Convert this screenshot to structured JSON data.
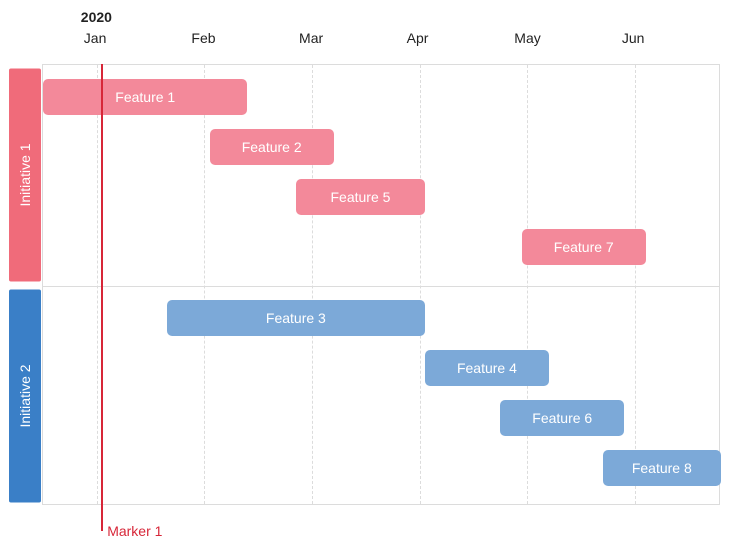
{
  "header": {
    "year": "2020",
    "months": [
      "Jan",
      "Feb",
      "Mar",
      "Apr",
      "May",
      "Jun"
    ]
  },
  "swimlanes": [
    {
      "id": "initiative-1",
      "label": "Initiative 1",
      "color": "pink"
    },
    {
      "id": "initiative-2",
      "label": "Initiative 2",
      "color": "blue"
    }
  ],
  "bars": [
    {
      "id": "feature-1",
      "label": "Feature 1",
      "lane": 0,
      "row": 0,
      "color": "pink"
    },
    {
      "id": "feature-2",
      "label": "Feature 2",
      "lane": 0,
      "row": 1,
      "color": "pink"
    },
    {
      "id": "feature-5",
      "label": "Feature 5",
      "lane": 0,
      "row": 2,
      "color": "pink"
    },
    {
      "id": "feature-7",
      "label": "Feature 7",
      "lane": 0,
      "row": 3,
      "color": "pink"
    },
    {
      "id": "feature-3",
      "label": "Feature 3",
      "lane": 1,
      "row": 0,
      "color": "blue"
    },
    {
      "id": "feature-4",
      "label": "Feature 4",
      "lane": 1,
      "row": 1,
      "color": "blue"
    },
    {
      "id": "feature-6",
      "label": "Feature 6",
      "lane": 1,
      "row": 2,
      "color": "blue"
    },
    {
      "id": "feature-8",
      "label": "Feature 8",
      "lane": 1,
      "row": 3,
      "color": "blue"
    }
  ],
  "marker": {
    "label": "Marker 1"
  },
  "chart_data": {
    "type": "bar",
    "title": "",
    "xlabel": "",
    "ylabel": "",
    "x_unit": "month",
    "x_start": "2020-01",
    "categories": [
      "Jan",
      "Feb",
      "Mar",
      "Apr",
      "May",
      "Jun"
    ],
    "swimlanes": [
      "Initiative 1",
      "Initiative 2"
    ],
    "series": [
      {
        "name": "Feature 1",
        "swimlane": "Initiative 1",
        "start": 0.0,
        "end": 1.9
      },
      {
        "name": "Feature 2",
        "swimlane": "Initiative 1",
        "start": 1.55,
        "end": 2.7
      },
      {
        "name": "Feature 5",
        "swimlane": "Initiative 1",
        "start": 2.35,
        "end": 3.55
      },
      {
        "name": "Feature 7",
        "swimlane": "Initiative 1",
        "start": 4.45,
        "end": 5.6
      },
      {
        "name": "Feature 3",
        "swimlane": "Initiative 2",
        "start": 1.15,
        "end": 3.55
      },
      {
        "name": "Feature 4",
        "swimlane": "Initiative 2",
        "start": 3.55,
        "end": 4.7
      },
      {
        "name": "Feature 6",
        "swimlane": "Initiative 2",
        "start": 4.25,
        "end": 5.4
      },
      {
        "name": "Feature 8",
        "swimlane": "Initiative 2",
        "start": 5.2,
        "end": 6.3
      }
    ],
    "markers": [
      {
        "name": "Marker 1",
        "x": 0.55
      }
    ],
    "xlim": [
      0,
      6.3
    ]
  }
}
